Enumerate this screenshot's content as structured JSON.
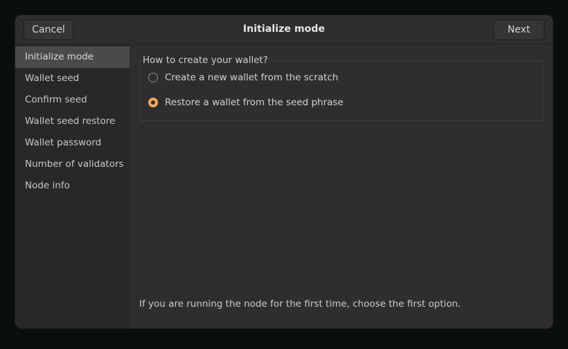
{
  "window": {
    "title": "Initialize mode",
    "cancel_label": "Cancel",
    "next_label": "Next"
  },
  "sidebar": {
    "items": [
      {
        "label": "Initialize mode",
        "selected": true
      },
      {
        "label": "Wallet seed",
        "selected": false
      },
      {
        "label": "Confirm seed",
        "selected": false
      },
      {
        "label": "Wallet seed restore",
        "selected": false
      },
      {
        "label": "Wallet password",
        "selected": false
      },
      {
        "label": "Number of validators",
        "selected": false
      },
      {
        "label": "Node info",
        "selected": false
      }
    ]
  },
  "main": {
    "group_legend": "How to create your wallet?",
    "options": [
      {
        "label": "Create a new wallet from the scratch",
        "selected": false
      },
      {
        "label": "Restore a wallet from the seed phrase",
        "selected": true
      }
    ],
    "hint": "If you are running the node for the first time, choose the first option."
  },
  "colors": {
    "accent": "#f5a85c",
    "window_bg": "#2e2e2e",
    "sidebar_bg": "#282828",
    "sidebar_selected_bg": "#4a4a4a",
    "text": "#d2d2d2",
    "desktop": "#000000"
  }
}
